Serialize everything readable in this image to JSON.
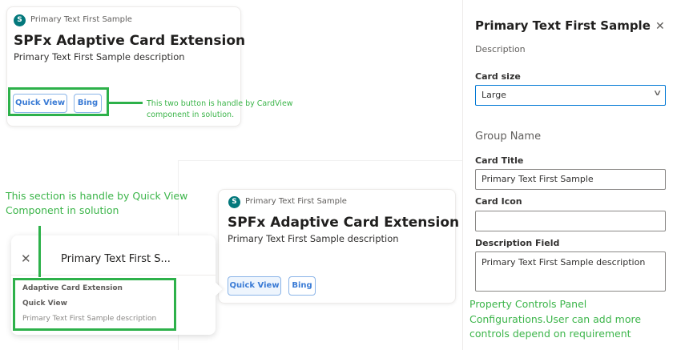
{
  "card_view": {
    "header": "Primary Text First Sample",
    "title": "SPFx Adaptive Card Extension",
    "description": "Primary Text First Sample description",
    "buttons": [
      "Quick View",
      "Bing"
    ],
    "annotation": [
      "This two button is handle by CardView",
      "component in solution."
    ]
  },
  "card_view_2": {
    "header": "Primary Text First Sample",
    "title": "SPFx Adaptive Card Extension",
    "description": "Primary Text First Sample description",
    "buttons": [
      "Quick View",
      "Bing"
    ]
  },
  "quick_view": {
    "annotation": [
      "This section is handle by Quick View",
      "Component in solution"
    ],
    "title": "Primary Text First S...",
    "lines": [
      "Adaptive Card Extension",
      "Quick View",
      "Primary Text First Sample description"
    ]
  },
  "panel": {
    "title": "Primary Text First Sample",
    "description": "Description",
    "card_size_label": "Card size",
    "card_size_value": "Large",
    "group_name": "Group Name",
    "card_title_label": "Card Title",
    "card_title_value": "Primary Text First Sample",
    "card_icon_label": "Card Icon",
    "card_icon_value": "",
    "description_field_label": "Description Field",
    "description_field_value": "Primary Text First Sample description",
    "annotation": [
      "Property Controls Panel",
      "Configurations.User can add more",
      "controls depend on requirement"
    ]
  },
  "icon_letter": "S"
}
